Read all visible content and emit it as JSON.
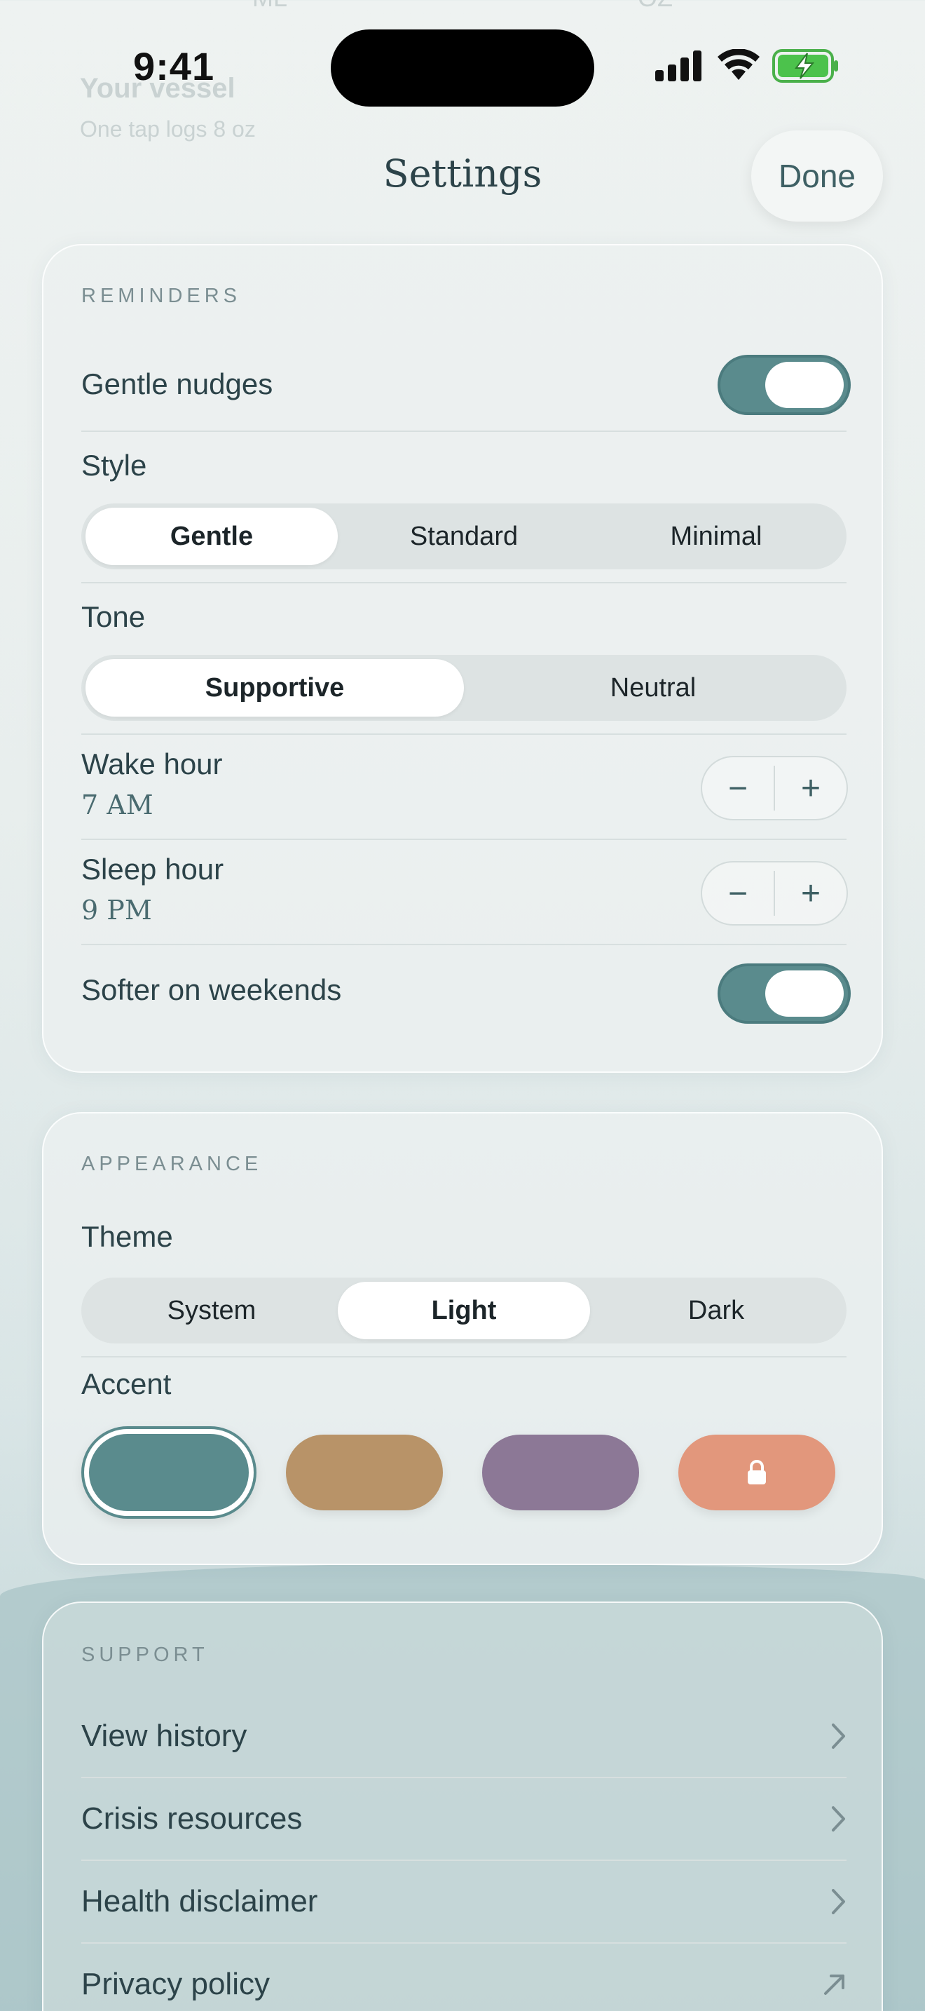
{
  "status_bar": {
    "time": "9:41"
  },
  "background_ghost": {
    "t1": "Your vessel",
    "t2": "One tap logs 8 oz",
    "t3": "ML",
    "t4": "OZ"
  },
  "header": {
    "title": "Settings",
    "done_label": "Done"
  },
  "reminders": {
    "section_title": "REMINDERS",
    "gentle_nudges_label": "Gentle nudges",
    "gentle_nudges_on": true,
    "style_label": "Style",
    "style_options": [
      "Gentle",
      "Standard",
      "Minimal"
    ],
    "style_selected": "Gentle",
    "tone_label": "Tone",
    "tone_options": [
      "Supportive",
      "Neutral"
    ],
    "tone_selected": "Supportive",
    "wake_label": "Wake hour",
    "wake_value": "7 AM",
    "sleep_label": "Sleep hour",
    "sleep_value": "9 PM",
    "weekends_label": "Softer on weekends",
    "weekends_on": true,
    "minus": "−",
    "plus": "+"
  },
  "appearance": {
    "section_title": "APPEARANCE",
    "theme_label": "Theme",
    "theme_options": [
      "System",
      "Light",
      "Dark"
    ],
    "theme_selected": "Light",
    "accent_label": "Accent",
    "accent_colors": [
      "#5a8b8d",
      "#b89368",
      "#8c7896",
      "#e2977c"
    ],
    "accent_selected_index": 0,
    "locked_index": 3
  },
  "support": {
    "section_title": "SUPPORT",
    "items": [
      {
        "label": "View history",
        "icon": "chevron-right-icon"
      },
      {
        "label": "Crisis resources",
        "icon": "chevron-right-icon"
      },
      {
        "label": "Health disclaimer",
        "icon": "chevron-right-icon"
      },
      {
        "label": "Privacy policy",
        "icon": "external-arrow-icon"
      }
    ]
  }
}
